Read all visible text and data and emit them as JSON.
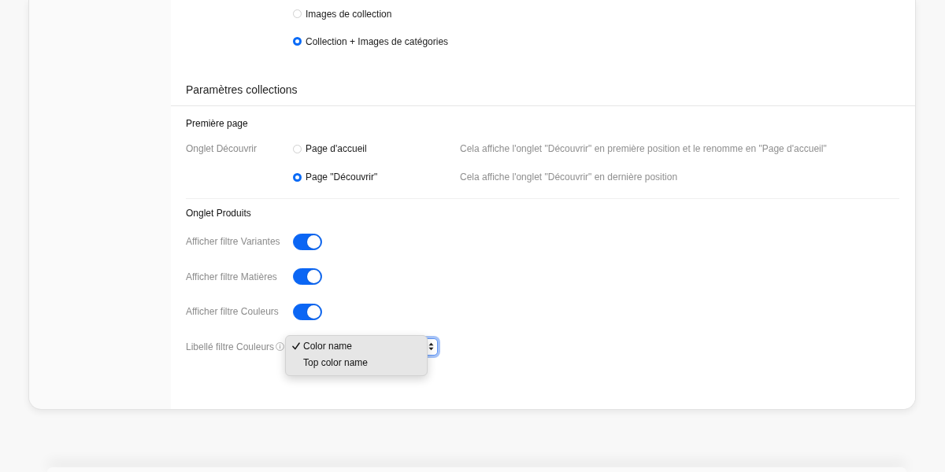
{
  "image_mode": {
    "options": [
      {
        "label": "Images de collection",
        "selected": false
      },
      {
        "label": "Collection + Images de catégories",
        "selected": true
      }
    ]
  },
  "section": {
    "title": "Paramètres collections",
    "groups": [
      {
        "title": "Première page",
        "rows": [
          {
            "kind": "radio",
            "label": "Onglet Découvrir",
            "options": [
              {
                "label": "Page d'accueil",
                "selected": false,
                "description": "Cela affiche l'onglet \"Découvrir\" en première position et le renomme en \"Page d'accueil\""
              },
              {
                "label": "Page \"Découvrir\"",
                "selected": true,
                "description": "Cela affiche l'onglet \"Découvrir\" en dernière position"
              }
            ]
          }
        ]
      },
      {
        "title": "Onglet Produits",
        "rows": [
          {
            "kind": "switch",
            "label": "Afficher filtre Variantes",
            "on": true
          },
          {
            "kind": "switch",
            "label": "Afficher filtre Matières",
            "on": true
          },
          {
            "kind": "switch",
            "label": "Afficher filtre Couleurs",
            "on": true
          },
          {
            "kind": "select",
            "label": "Libellé filtre Couleurs",
            "expanded": true,
            "options": [
              {
                "label": "Color name",
                "selected": true
              },
              {
                "label": "Top color name",
                "selected": false
              }
            ]
          }
        ]
      }
    ]
  }
}
